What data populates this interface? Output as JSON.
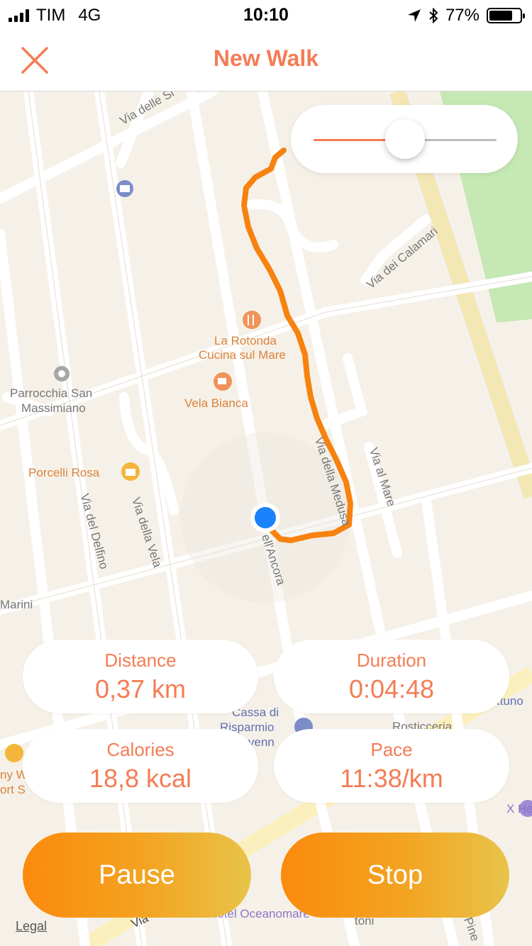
{
  "status_bar": {
    "carrier": "TIM",
    "network": "4G",
    "time": "10:10",
    "battery": "77%",
    "battery_level": 0.77
  },
  "nav": {
    "title": "New Walk"
  },
  "slider": {
    "value": 0.5
  },
  "map": {
    "labels": {
      "via_delle_sirene": "Via delle Si",
      "via_dei_calamari": "Via dei Calamari",
      "la_rotonda_1": "La Rotonda",
      "la_rotonda_2": "Cucina sul Mare",
      "vela_bianca": "Vela Bianca",
      "parrocchia_1": "Parrocchia San",
      "parrocchia_2": "Massimiano",
      "porcelli_rosa": "Porcelli Rosa",
      "via_della_vela": "Via della Vela",
      "via_del_delfino": "Via del Delfino",
      "via_della_medusa": "Via della Medusa",
      "via_al_mare": "Via al Mare",
      "via_ancora": "ell'Ancora",
      "marini": "Marini",
      "cassa_1": "Cassa di",
      "cassa_2": "Risparmio",
      "cassa_3": "venn",
      "rosticceria": "Rosticceria",
      "nettuno": "ttuno",
      "x_hotel": "X He",
      "sport_1": "ny W",
      "sport_2": "ort S",
      "hotel_oceanomare": "Hotel Oceanomare",
      "via_bottom": "Via",
      "toni": "toni",
      "pine": "Pine"
    }
  },
  "stats": {
    "distance": {
      "label": "Distance",
      "value": "0,37 km"
    },
    "duration": {
      "label": "Duration",
      "value": "0:04:48"
    },
    "calories": {
      "label": "Calories",
      "value": "18,8 kcal"
    },
    "pace": {
      "label": "Pace",
      "value": "11:38/km"
    }
  },
  "buttons": {
    "pause": "Pause",
    "stop": "Stop"
  },
  "legal": "Legal",
  "colors": {
    "accent": "#f47c55",
    "route": "#f7820f",
    "location": "#1a82fb"
  }
}
